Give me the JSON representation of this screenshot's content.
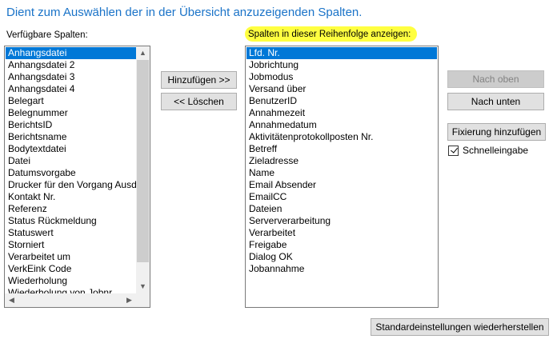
{
  "heading": "Dient zum Auswählen der in der Übersicht anzuzeigenden Spalten.",
  "available": {
    "label": "Verfügbare Spalten:",
    "items": [
      "Anhangsdatei",
      "Anhangsdatei 2",
      "Anhangsdatei 3",
      "Anhangsdatei 4",
      "Belegart",
      "Belegnummer",
      "BerichtsID",
      "Berichtsname",
      "Bodytextdatei",
      "Datei",
      "Datumsvorgabe",
      "Drucker für den Vorgang Ausdr",
      "Kontakt Nr.",
      "Referenz",
      "Status Rückmeldung",
      "Statuswert",
      "Storniert",
      "Verarbeitet um",
      "VerkEink Code",
      "Wiederholung",
      "Wiederholung von Jobnr."
    ]
  },
  "selected": {
    "label": "Spalten in dieser Reihenfolge anzeigen:",
    "items": [
      "Lfd. Nr.",
      "Jobrichtung",
      "Jobmodus",
      "Versand über",
      "BenutzerID",
      "Annahmezeit",
      "Annahmedatum",
      "Aktivitätenprotokollposten Nr.",
      "Betreff",
      "Zieladresse",
      "Name",
      "Email Absender",
      "EmailCC",
      "Dateien",
      "Serververarbeitung",
      "Verarbeitet",
      "Freigabe",
      "Dialog OK",
      "Jobannahme"
    ]
  },
  "buttons": {
    "add": "Hinzufügen >>",
    "delete": "<< Löschen",
    "move_up": "Nach oben",
    "move_down": "Nach unten",
    "add_fixation": "Fixierung hinzufügen",
    "restore_defaults": "Standardeinstellungen wiederherstellen"
  },
  "quick_entry": {
    "label": "Schnelleingabe",
    "checked": true
  },
  "colors": {
    "accent": "#0078d7",
    "heading": "#1a73c8",
    "highlight": "#ffff40"
  }
}
